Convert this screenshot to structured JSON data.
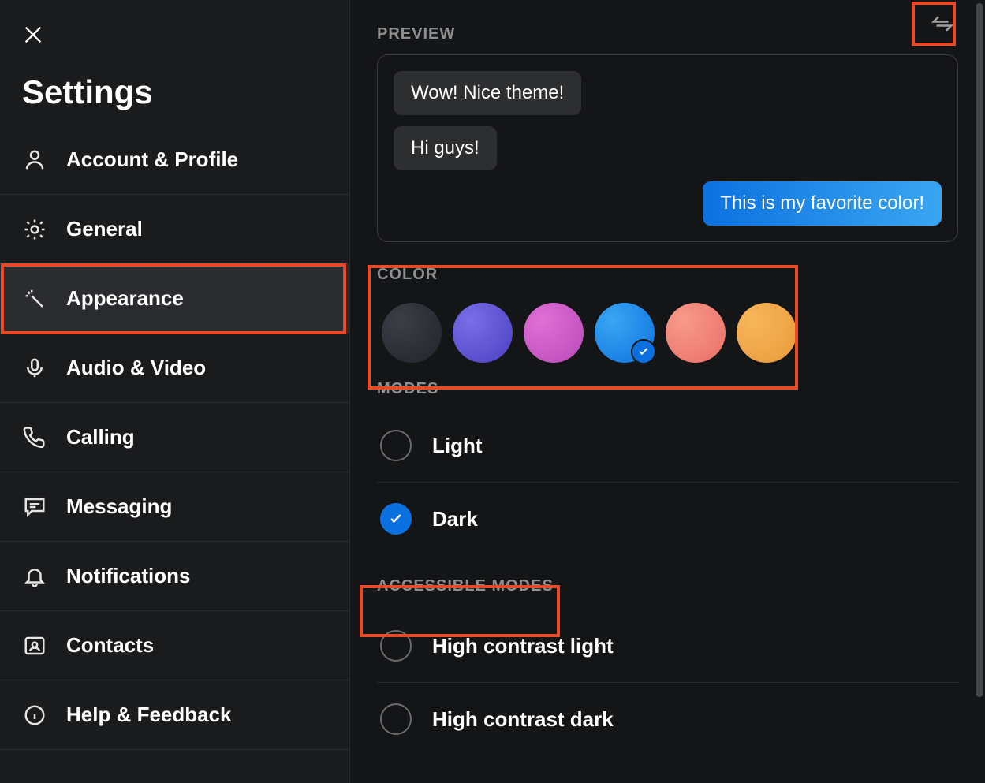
{
  "sidebar": {
    "title": "Settings",
    "items": [
      {
        "label": "Account & Profile"
      },
      {
        "label": "General"
      },
      {
        "label": "Appearance"
      },
      {
        "label": "Audio & Video"
      },
      {
        "label": "Calling"
      },
      {
        "label": "Messaging"
      },
      {
        "label": "Notifications"
      },
      {
        "label": "Contacts"
      },
      {
        "label": "Help & Feedback"
      }
    ]
  },
  "preview": {
    "header": "PREVIEW",
    "msg1": "Wow! Nice theme!",
    "msg2": "Hi guys!",
    "msg3": "This is my favorite color!"
  },
  "color": {
    "header": "COLOR",
    "swatches": [
      {
        "name": "default-dark",
        "css": "radial-gradient(circle at 30% 30%, #3a3e46, #22252a)",
        "selected": false
      },
      {
        "name": "purple",
        "css": "radial-gradient(circle at 30% 30%, #7a6fe8, #4a3fc0)",
        "selected": false
      },
      {
        "name": "pink",
        "css": "radial-gradient(circle at 30% 30%, #e06fd6, #b94ab8)",
        "selected": false
      },
      {
        "name": "blue",
        "css": "radial-gradient(circle at 30% 30%, #3aa6f2, #0c71e0)",
        "selected": true
      },
      {
        "name": "coral",
        "css": "radial-gradient(circle at 30% 30%, #f79a8a, #ea6e66)",
        "selected": false
      },
      {
        "name": "orange",
        "css": "radial-gradient(circle at 30% 30%, #f7b65a, #e89a3a)",
        "selected": false
      }
    ]
  },
  "modes": {
    "header": "MODES",
    "options": [
      {
        "label": "Light",
        "selected": false
      },
      {
        "label": "Dark",
        "selected": true
      }
    ]
  },
  "accessible": {
    "header": "ACCESSIBLE MODES",
    "options": [
      {
        "label": "High contrast light",
        "selected": false
      },
      {
        "label": "High contrast dark",
        "selected": false
      }
    ]
  }
}
